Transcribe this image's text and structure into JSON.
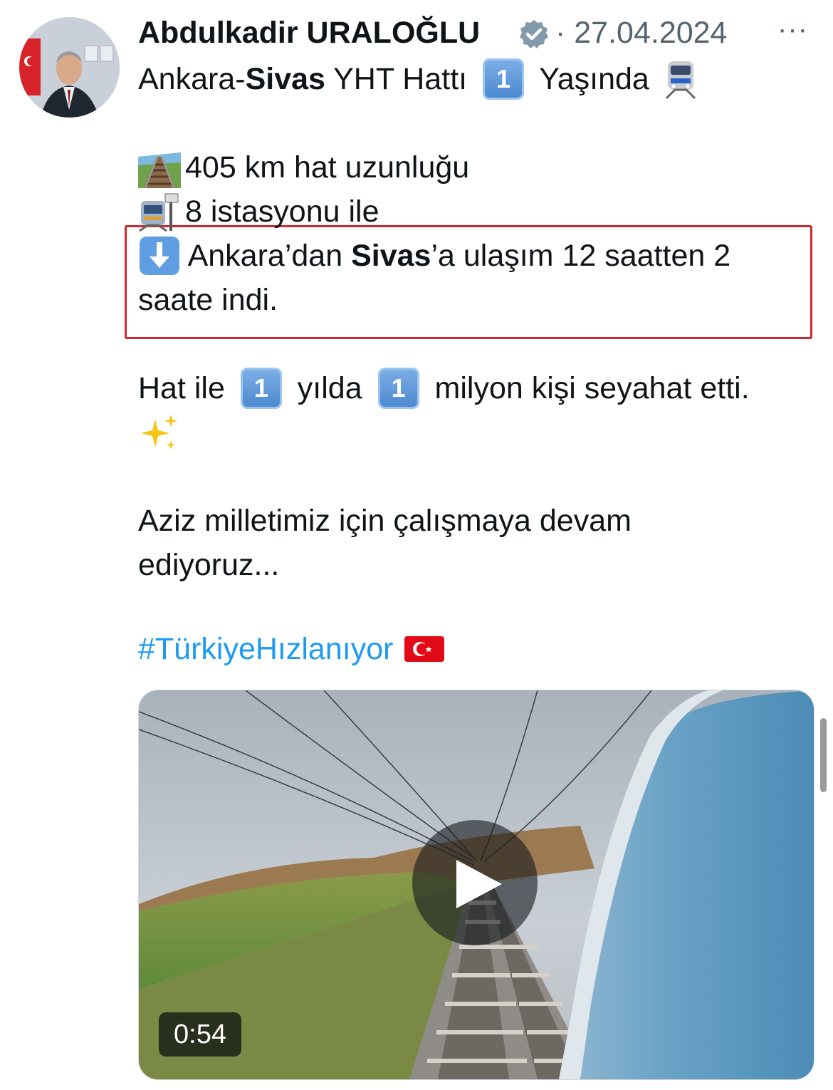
{
  "author": {
    "name": "Abdulkadir URALOĞLU",
    "date": "· 27.04.2024",
    "more": "···"
  },
  "tweet": {
    "line1": {
      "pre": "Ankara-",
      "bold": "Sivas",
      "mid": " YHT Hattı ",
      "box": "1",
      "post": " Yaşında"
    },
    "line2": "405 km hat uzunluğu",
    "line3": "8 istasyonu ile",
    "line4": {
      "pre": " Ankara’dan ",
      "bold": "Sivas",
      "post": "’a ulaşım 12 saatten 2"
    },
    "line5": "saate indi.",
    "line6": {
      "a": "Hat ile ",
      "box1": "1",
      "b": " yılda ",
      "box2": "1",
      "c": " milyon kişi seyahat etti."
    },
    "line8": "Aziz milletimiz için çalışmaya devam",
    "line9": "ediyoruz...",
    "hashtag": "#TürkiyeHızlanıyor"
  },
  "media": {
    "duration": "0:54"
  },
  "colors": {
    "highlight": "#d0282e",
    "hashtag": "#1d9bf0",
    "verified": "#829aab"
  }
}
